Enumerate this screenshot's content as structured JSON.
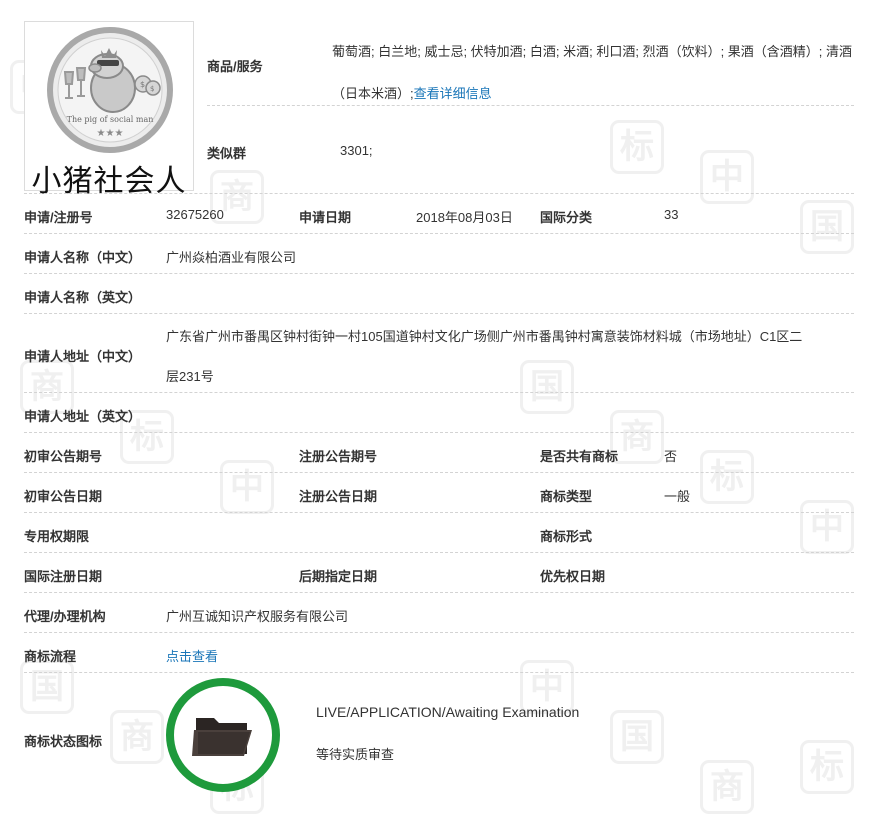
{
  "logo": {
    "caption": "小猪社会人",
    "small_text": "The pig of social man",
    "icon": "pig-with-crown-and-sunglasses"
  },
  "header": {
    "goods_label": "商品/服务",
    "goods_items": "葡萄酒; 白兰地; 威士忌; 伏特加酒; 白酒; 米酒; 利口酒; 烈酒（饮料）; 果酒（含酒精）; 清酒（日本米酒）;",
    "goods_link": "查看详细信息",
    "similar_label": "类似群",
    "similar_value": "3301;"
  },
  "fields": {
    "reg_no_label": "申请/注册号",
    "reg_no_value": "32675260",
    "apply_date_label": "申请日期",
    "apply_date_value": "2018年08月03日",
    "intl_class_label": "国际分类",
    "intl_class_value": "33",
    "applicant_cn_label": "申请人名称（中文）",
    "applicant_cn_value": "广州焱柏酒业有限公司",
    "applicant_en_label": "申请人名称（英文）",
    "address_cn_label": "申请人地址（中文）",
    "address_cn_line1": "广东省广州市番禺区钟村街钟一村105国道钟村文化广场侧广州市番禺钟村寓意装饰材料城（市场地址）C1区二",
    "address_cn_line2": "层231号",
    "address_en_label": "申请人地址（英文）",
    "prelim_no_label": "初审公告期号",
    "reg_pub_no_label": "注册公告期号",
    "shared_label": "是否共有商标",
    "shared_value": "否",
    "prelim_date_label": "初审公告日期",
    "reg_pub_date_label": "注册公告日期",
    "type_label": "商标类型",
    "type_value": "一般",
    "exclusive_label": "专用权期限",
    "form_label": "商标形式",
    "intl_reg_date_label": "国际注册日期",
    "later_date_label": "后期指定日期",
    "priority_date_label": "优先权日期",
    "agency_label": "代理/办理机构",
    "agency_value": "广州互诚知识产权服务有限公司",
    "process_label": "商标流程",
    "process_link": "点击查看",
    "status_label": "商标状态图标",
    "status_en": "LIVE/APPLICATION/Awaiting Examination",
    "status_cn": "等待实质审查"
  },
  "watermark": {
    "chars": [
      "中",
      "国",
      "商",
      "标"
    ],
    "color": "#f0f0f0"
  },
  "colors": {
    "link": "#1a76b8",
    "status_ring": "#1e9a3c",
    "label": "#333333"
  },
  "icons": {
    "status": "folder-icon"
  }
}
